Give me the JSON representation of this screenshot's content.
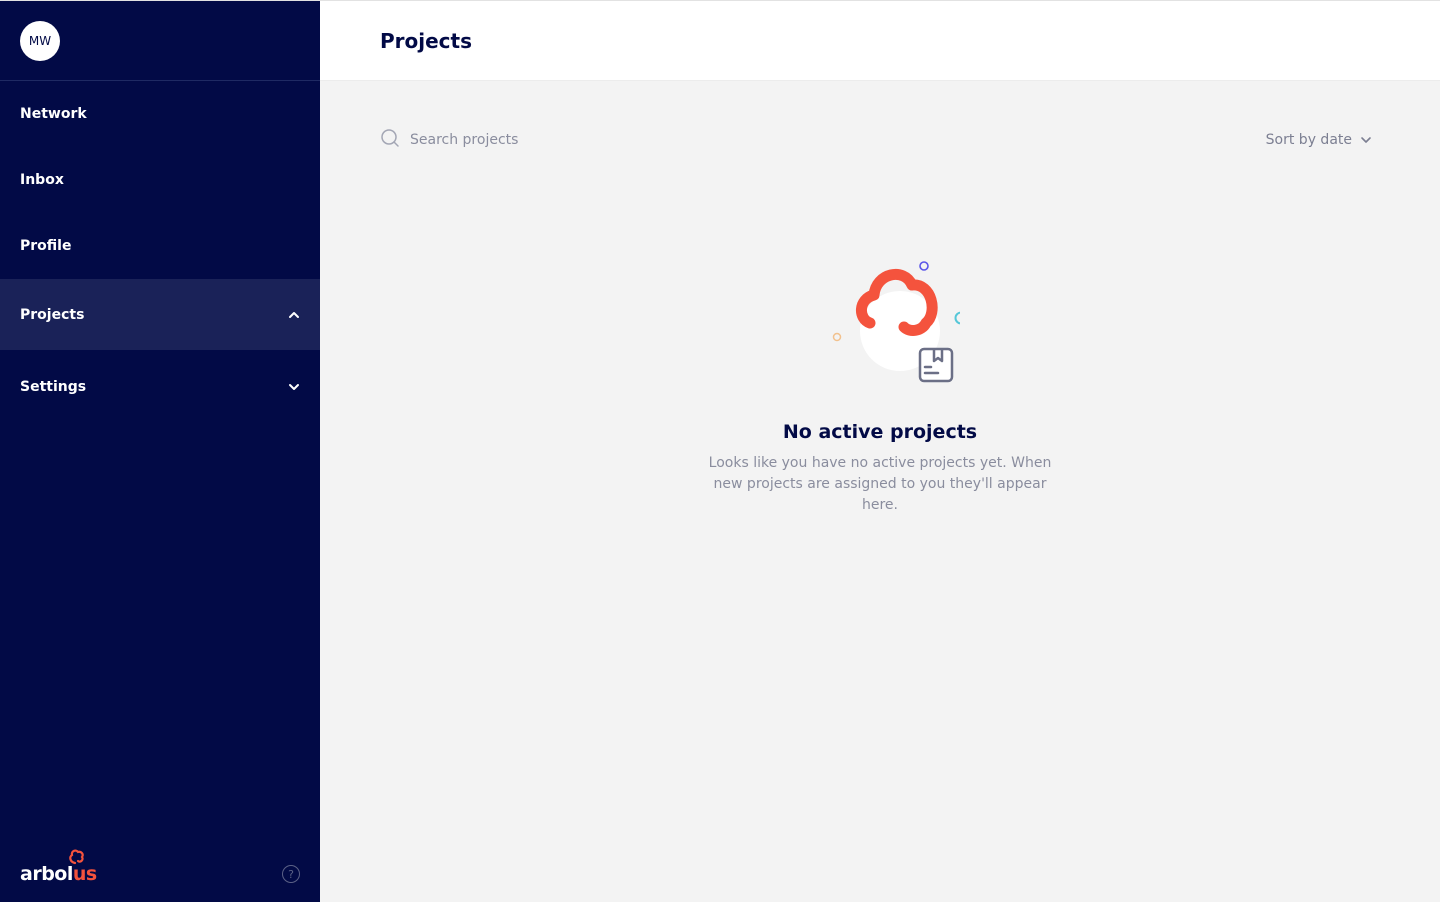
{
  "user": {
    "initials": "MW"
  },
  "sidebar": {
    "items": [
      {
        "label": "Network"
      },
      {
        "label": "Inbox"
      },
      {
        "label": "Profile"
      },
      {
        "label": "Projects",
        "expanded": true
      },
      {
        "label": "Settings",
        "expanded": false
      }
    ],
    "logo": {
      "prefix": "arbol",
      "suffix": "us"
    },
    "help_icon": "question-circle-icon"
  },
  "header": {
    "title": "Projects"
  },
  "toolbar": {
    "search_placeholder": "Search projects",
    "sort_label": "Sort by date"
  },
  "empty_state": {
    "title": "No active projects",
    "description": "Looks like you have no active projects yet. When new projects are assigned to you they'll appear here."
  },
  "colors": {
    "sidebar_bg": "#020a46",
    "accent": "#f4533d",
    "background": "#f3f3f3"
  }
}
